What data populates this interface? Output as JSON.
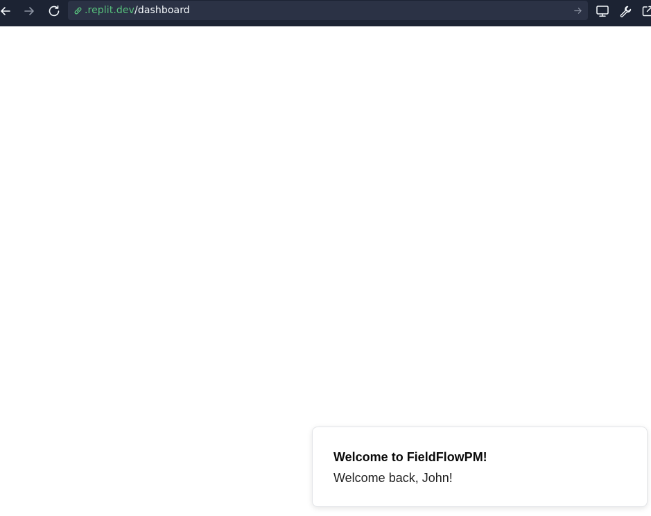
{
  "browser": {
    "url_domain": ".replit.dev",
    "url_path": "/dashboard",
    "icons": {
      "back": "arrow-left-icon",
      "forward": "arrow-right-icon",
      "reload": "reload-icon",
      "link": "link-icon",
      "go": "arrow-right-icon",
      "devices": "monitor-icon",
      "devtools": "wrench-icon",
      "open_new": "external-link-icon"
    },
    "colors": {
      "toolbar_bg": "#1c2333",
      "url_bg": "#2b3245",
      "domain": "#58c27d",
      "path": "#f5f9fc"
    }
  },
  "toast": {
    "title": "Welcome to FieldFlowPM!",
    "description": "Welcome back, John!"
  }
}
